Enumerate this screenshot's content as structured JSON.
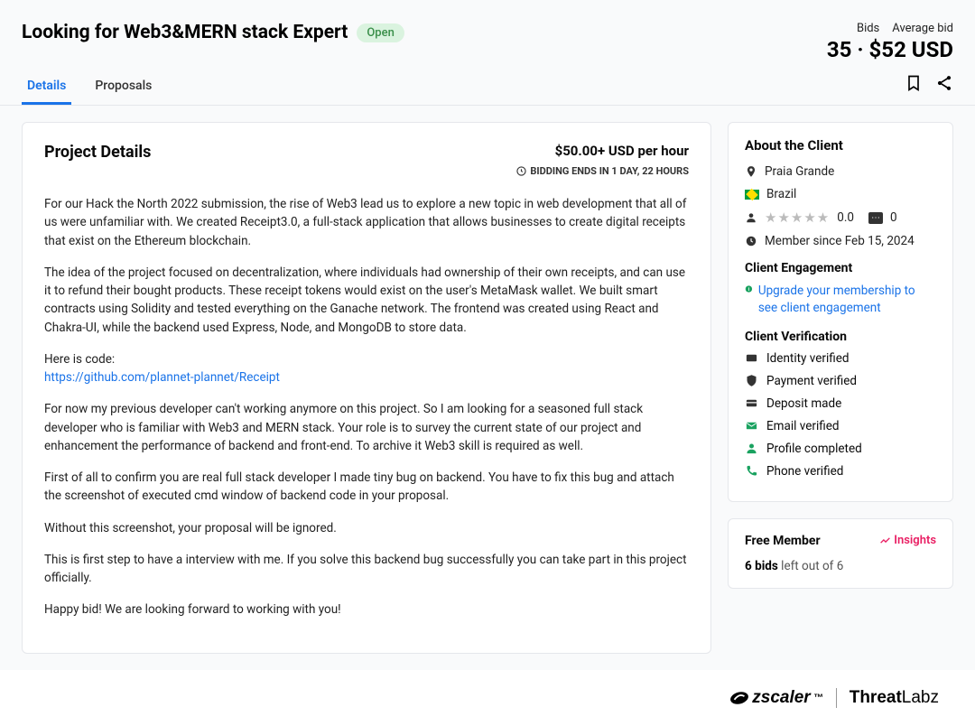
{
  "header": {
    "title": "Looking for Web3&MERN stack Expert",
    "status": "Open",
    "bids_label": "Bids",
    "avg_bid_label": "Average bid",
    "bids_value": "35",
    "dot": " · ",
    "avg_bid_value": "$52 USD"
  },
  "tabs": {
    "details": "Details",
    "proposals": "Proposals"
  },
  "project": {
    "heading": "Project Details",
    "rate": "$50.00+ USD per hour",
    "bidding_ends": "BIDDING ENDS IN 1 DAY, 22 HOURS",
    "p1": "For our Hack the North 2022 submission, the rise of Web3 lead us to explore a new topic in web development that all of us were unfamiliar with. We created Receipt3.0, a full-stack application that allows businesses to create digital receipts that exist on the Ethereum blockchain.",
    "p2": "The idea of the project focused on decentralization, where individuals had ownership of their own receipts, and can use it to refund their bought products. These receipt tokens would exist on the user's MetaMask wallet. We built smart contracts using Solidity and tested everything on the Ganache network. The frontend was created using React and Chakra-UI, while the backend used Express, Node, and MongoDB to store data.",
    "p3": "Here is code:",
    "code_link": "https://github.com/plannet-plannet/Receipt",
    "p4": "For now my previous developer can't working anymore on this project. So I am looking for a seasoned full stack developer who is familiar with Web3 and MERN stack. Your role is to survey the current state of our project and enhancement the performance of backend and front-end. To archive it Web3 skill is required as well.",
    "p5": "First of all to confirm you are real full stack developer I made tiny bug on backend. You have to fix this bug and attach the screenshot of executed cmd window of backend code in your proposal.",
    "p6": "Without this screenshot, your proposal will be ignored.",
    "p7": "This is first step to have a interview with me. If you solve this backend bug successfully you can take part in this project officially.",
    "p8": "Happy bid! We are looking forward to working with you!"
  },
  "client": {
    "heading": "About the Client",
    "city": "Praia Grande",
    "country": "Brazil",
    "rating": "0.0",
    "reviews": "0",
    "member_since": "Member since Feb 15, 2024",
    "engagement_heading": "Client Engagement",
    "upgrade_text": "Upgrade your membership to see client engagement",
    "verification_heading": "Client Verification",
    "verif": {
      "identity": "Identity verified",
      "payment": "Payment verified",
      "deposit": "Deposit made",
      "email": "Email verified",
      "profile": "Profile completed",
      "phone": "Phone verified"
    }
  },
  "membership": {
    "tier": "Free Member",
    "insights": "Insights",
    "bids_bold": "6 bids",
    "bids_rest": " left out of 6"
  },
  "footer": {
    "zscaler": "zscaler",
    "threatlabz_a": "Threat",
    "threatlabz_b": "Labz"
  }
}
